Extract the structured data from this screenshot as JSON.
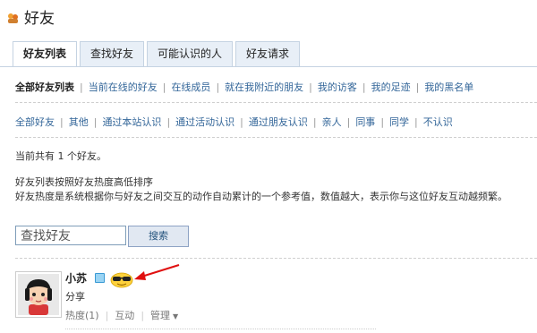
{
  "header": {
    "title": "好友"
  },
  "tabs": [
    {
      "label": "好友列表"
    },
    {
      "label": "查找好友"
    },
    {
      "label": "可能认识的人"
    },
    {
      "label": "好友请求"
    }
  ],
  "nav1": [
    {
      "label": "全部好友列表"
    },
    {
      "label": "当前在线的好友"
    },
    {
      "label": "在线成员"
    },
    {
      "label": "就在我附近的朋友"
    },
    {
      "label": "我的访客"
    },
    {
      "label": "我的足迹"
    },
    {
      "label": "我的黑名单"
    }
  ],
  "nav2": [
    {
      "label": "全部好友"
    },
    {
      "label": "其他"
    },
    {
      "label": "通过本站认识"
    },
    {
      "label": "通过活动认识"
    },
    {
      "label": "通过朋友认识"
    },
    {
      "label": "亲人"
    },
    {
      "label": "同事"
    },
    {
      "label": "同学"
    },
    {
      "label": "不认识"
    }
  ],
  "info": {
    "count": "当前共有 1 个好友。",
    "sort_title": "好友列表按照好友热度高低排序",
    "sort_desc": "好友热度是系统根据你与好友之间交互的动作自动累计的一个参考值，数值越大，表示你与这位好友互动越频繁。"
  },
  "search": {
    "value": "查找好友",
    "button": "搜索"
  },
  "friend": {
    "name": "小苏",
    "share": "分享",
    "heat": "热度(1)",
    "interact": "互动",
    "manage": "管理"
  },
  "colors": {
    "link": "#336699",
    "tab_bg": "#e8eff7",
    "tab_border": "#c5d3e2",
    "arrow": "#e01010"
  }
}
